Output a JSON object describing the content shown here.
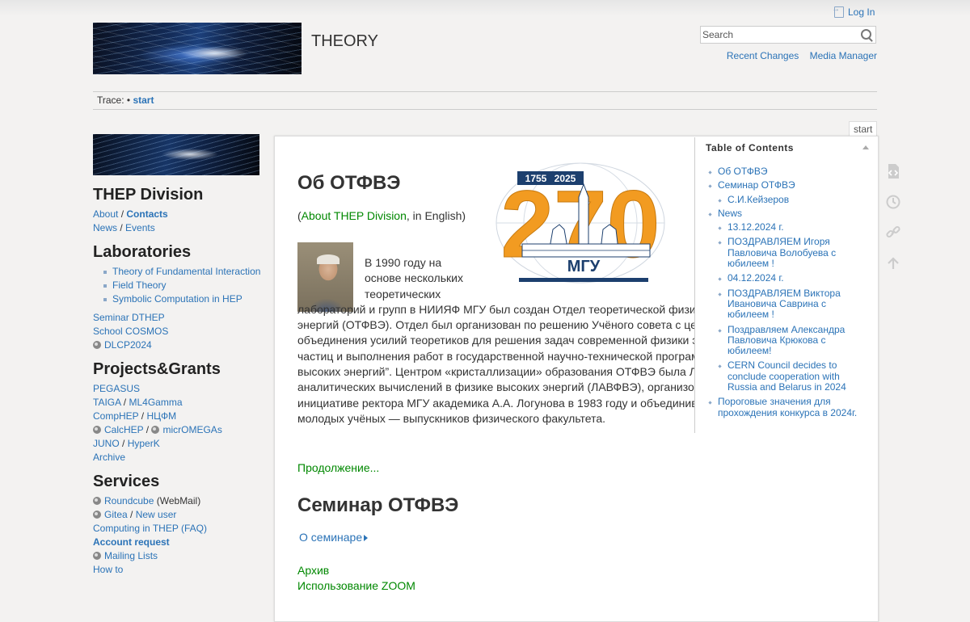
{
  "header": {
    "site_title": "THEORY",
    "login_label": "Log In",
    "search_placeholder": "Search",
    "recent_changes": "Recent Changes",
    "media_manager": "Media Manager"
  },
  "trace": {
    "label": "Trace:",
    "bullet": "•",
    "current": "start"
  },
  "page_id": "start",
  "sidebar": {
    "division_title": "THEP Division",
    "about": "About",
    "contacts": "Contacts",
    "news": "News",
    "events": "Events",
    "labs_title": "Laboratories",
    "labs": [
      "Theory of Fundamental Interaction",
      "Field Theory",
      "Symbolic Computation in HEP"
    ],
    "seminar": "Seminar DTHEP",
    "school": "School COSMOS",
    "dlcp": "DLCP2024",
    "projects_title": "Projects&Grants",
    "pegasus": "PEGASUS",
    "taiga": "TAIGA",
    "ml4gamma": "ML4Gamma",
    "comphep": "CompHEP",
    "ncfm": "НЦФМ",
    "calchep": "CalcHEP",
    "micromegas": "micrOMEGAs",
    "juno": "JUNO",
    "hyperk": "HyperK",
    "archive": "Archive",
    "services_title": "Services",
    "roundcube": "Roundcube",
    "webmail": "(WebMail)",
    "gitea": "Gitea",
    "new_user": "New user",
    "computing": "Computing in THEP (FAQ)",
    "account_request": "Account request",
    "mailing_lists": "Mailing Lists",
    "howto": "How to"
  },
  "content": {
    "heading1": "Об ОТФВЭ",
    "about_open": "(",
    "about_link": "About THEP Division",
    "about_rest": ", in English)",
    "para_indent": "В 1990 году на основе нескольких теоретических",
    "para_rest": "лабораторий и групп в НИИЯФ МГУ был создан Отдел теоретической физики высоких энергий (ОТФВЭ). Отдел был организован по решению Учёного совета с целью объединения усилий теоретиков для решения задач современной физики элементарных частиц и выполнения работ в государственной научно-технической программы “Физика высоких энергий”. Центром «кристаллизации» образования ОТФВЭ была Лаборатория аналитических вычислений в физике высоких энергий (ЛАВФВЭ), организованная по инициативе ректора МГУ академика А.А. Логунова в 1983 году и объединившая ряд молодых учёных — выпускников физического факультета.",
    "more": "Продолжение...",
    "heading2": "Семинар ОТФВЭ",
    "seminar_link": "О семинаре",
    "archive": "Архив",
    "zoom": "Использование ZOOM"
  },
  "logo": {
    "year_start": "1755",
    "year_end": "2025",
    "number": "270",
    "caption": "МГУ",
    "orange": "#f29b21",
    "navy": "#1c3f6e"
  },
  "toc": {
    "title": "Table of Contents",
    "items": [
      "Об ОТФВЭ",
      "Семинар ОТФВЭ",
      "С.И.Кейзеров",
      "News",
      "13.12.2024 г.",
      "ПОЗДРАВЛЯЕМ Игоря Павловича Волобуева с юбилеем !",
      "04.12.2024 г.",
      "ПОЗДРАВЛЯЕМ Виктора Ивановича Саврина с юбилеем !",
      "Поздравляем Александра Павловича Крюкова с юбилеем!",
      "CERN Council decides to conclude cooperation with Russia and Belarus in 2024",
      "Пороговые значения для прохождения конкурса в 2024г."
    ]
  },
  "rail_icons": [
    "show-source-icon",
    "old-revisions-icon",
    "backlinks-icon",
    "back-to-top-icon"
  ],
  "colors": {
    "link": "#2b73b7",
    "green_link": "#008800",
    "background": "#f3f2f1"
  }
}
